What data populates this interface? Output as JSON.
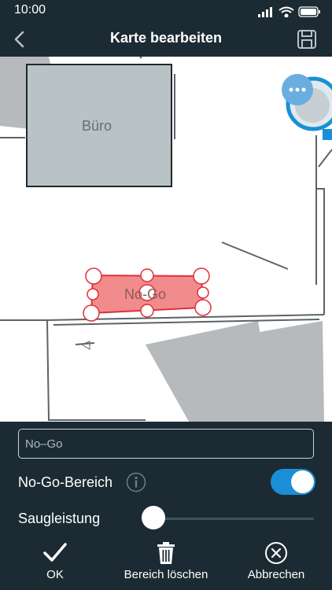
{
  "status": {
    "time": "10:00"
  },
  "header": {
    "title": "Karte bearbeiten"
  },
  "map": {
    "room_label": "Büro",
    "nogo_label": "No-Go"
  },
  "panel": {
    "name_value": "No–Go",
    "nogo_toggle_label": "No-Go-Bereich",
    "nogo_enabled": true,
    "suction_label": "Saugleistung",
    "suction_level": 0
  },
  "actions": {
    "ok_label": "OK",
    "delete_label": "Bereich löschen",
    "cancel_label": "Abbrechen"
  },
  "colors": {
    "background": "#1c2b33",
    "accent": "#1a8fd6",
    "nogo_fill": "#f28b8b",
    "nogo_stroke": "#e0303a"
  }
}
